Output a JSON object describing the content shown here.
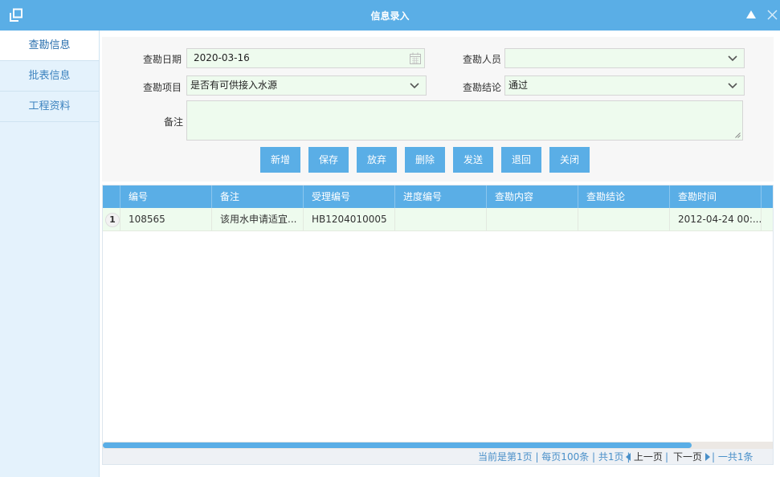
{
  "window": {
    "title": "信息录入"
  },
  "sidebar": {
    "items": [
      {
        "label": "查勘信息",
        "active": true
      },
      {
        "label": "批表信息",
        "active": false
      },
      {
        "label": "工程资料",
        "active": false
      }
    ]
  },
  "form": {
    "survey_date_label": "查勘日期",
    "survey_date_value": "2020-03-16",
    "surveyor_label": "查勘人员",
    "surveyor_value": "",
    "survey_item_label": "查勘项目",
    "survey_item_value": "是否有可供接入水源",
    "conclusion_label": "查勘结论",
    "conclusion_value": "通过",
    "remark_label": "备注",
    "remark_value": ""
  },
  "buttons": {
    "add": "新增",
    "save": "保存",
    "discard": "放弃",
    "delete": "删除",
    "send": "发送",
    "return": "退回",
    "close": "关闭"
  },
  "table": {
    "columns": [
      "编号",
      "备注",
      "受理编号",
      "进度编号",
      "查勘内容",
      "查勘结论",
      "查勘时间"
    ],
    "rows": [
      {
        "index": "1",
        "cells": [
          "108565",
          "该用水申请适宜...",
          "HB1204010005",
          "",
          "",
          "",
          "2012-04-24 00:..."
        ]
      }
    ]
  },
  "pager": {
    "info": "当前是第1页 | 每页100条 | 共1页 |",
    "prev": "上一页",
    "sep": "|",
    "next": "下一页",
    "total": "| 一共1条"
  },
  "colors": {
    "accent": "#5aaee6",
    "sidebar_bg": "#e4f2fc",
    "field_bg": "#eefbee"
  }
}
